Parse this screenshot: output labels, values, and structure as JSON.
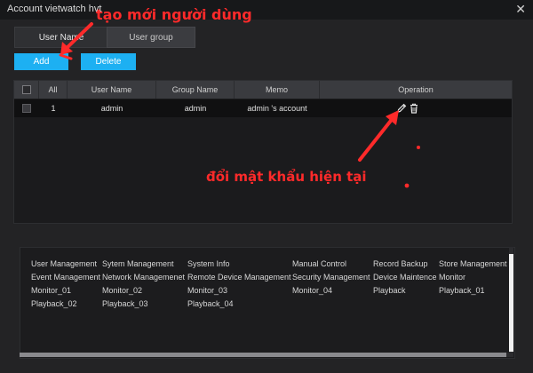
{
  "window": {
    "title": "Account vietwatch hvt",
    "close_glyph": "✕"
  },
  "tabs": [
    {
      "label": "User Name",
      "active": true
    },
    {
      "label": "User group",
      "active": false
    }
  ],
  "toolbar": {
    "add_label": "Add",
    "delete_label": "Delete"
  },
  "table": {
    "columns": [
      "All",
      "User Name",
      "Group Name",
      "Memo",
      "Operation"
    ],
    "rows": [
      {
        "index": "1",
        "user_name": "admin",
        "group_name": "admin",
        "memo": "admin 's account"
      }
    ],
    "row_icons": [
      "edit-icon",
      "delete-icon"
    ]
  },
  "annotations": [
    {
      "text": "tạo mới người dùng",
      "color": "#ff2a2a"
    },
    {
      "text": "đổi mật khẩu hiện tại",
      "color": "#ff2a2a"
    }
  ],
  "permissions": [
    [
      "User Management",
      "Sytem Management",
      "System Info",
      "Manual Control",
      "Record Backup",
      "Store Management"
    ],
    [
      "Event Management",
      "Network Managemenet",
      "Remote Device Management",
      "Security Management",
      "Device Maintence",
      "Monitor"
    ],
    [
      "Monitor_01",
      "Monitor_02",
      "Monitor_03",
      "Monitor_04",
      "Playback",
      "Playback_01"
    ],
    [
      "Playback_02",
      "Playback_03",
      "Playback_04"
    ]
  ],
  "colors": {
    "accent": "#1db0f2",
    "annotation": "#ff2a2a",
    "background": "#232325"
  }
}
